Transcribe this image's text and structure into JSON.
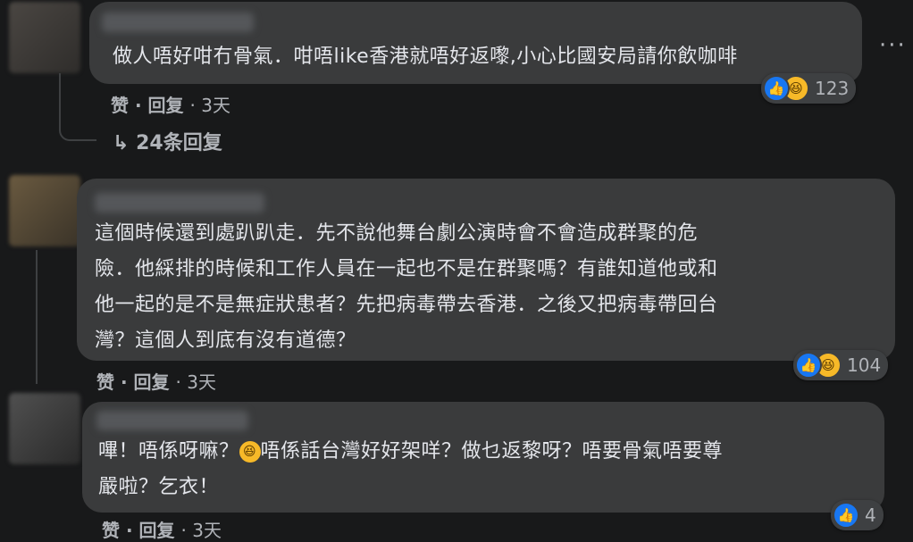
{
  "comments": [
    {
      "text_lines": [
        "做人唔好咁冇骨氣．咁唔like香港就唔好返嚟,小心比國安局請你飲咖啡"
      ],
      "like_label": "赞",
      "reply_label": "回复",
      "time": "· 3天",
      "reaction_count": "123",
      "replies_label": "↳ 24条回复"
    },
    {
      "text_lines": [
        "這個時候還到處趴趴走．先不說他舞台劇公演時會不會造成群聚的危",
        "險．他綵排的時候和工作人員在一起也不是在群聚嗎？有誰知道他或和",
        "他一起的是不是無症狀患者？先把病毒帶去香港．之後又把病毒帶回台",
        "灣？這個人到底有沒有道德？"
      ],
      "like_label": "赞",
      "reply_label": "回复",
      "time": "· 3天",
      "reaction_count": "104"
    },
    {
      "text_before_emoji": "嗶！唔係呀嘛？",
      "text_after_emoji": "唔係話台灣好好架咩？做乜返黎呀？唔要骨氣唔要尊",
      "text_line2": "嚴啦？乞衣！",
      "like_label": "赞",
      "reply_label": "回复",
      "time": "· 3天",
      "reaction_count": "4"
    }
  ],
  "more_options": "···",
  "icons": {
    "like": "like-icon",
    "haha": "haha-icon",
    "emoji": "laughing-emoji-icon"
  },
  "colors": {
    "background": "#18191a",
    "bubble": "#3a3b3c",
    "like_blue": "#1877f2",
    "haha_yellow": "#f7b928"
  }
}
